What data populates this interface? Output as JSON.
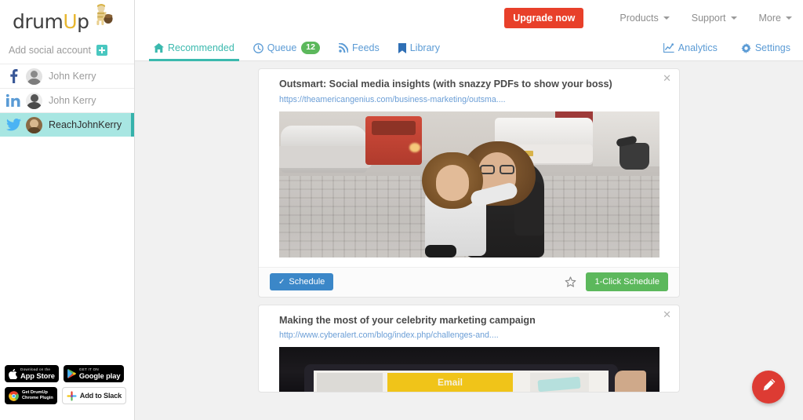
{
  "brand": {
    "name_part1": "drum",
    "name_part2": "U",
    "name_part3": "p",
    "accent_teal": "#3bb9ae",
    "accent_red": "#e8402a",
    "accent_green": "#5cb85c",
    "accent_blue": "#3b87c8"
  },
  "topbar": {
    "upgrade_label": "Upgrade now",
    "menu": [
      {
        "label": "Products",
        "icon": "chevron-down-icon"
      },
      {
        "label": "Support",
        "icon": "chevron-down-icon"
      },
      {
        "label": "More",
        "icon": "chevron-down-icon"
      }
    ]
  },
  "tabs": {
    "items": [
      {
        "label": "Recommended",
        "icon": "home-icon",
        "active": true,
        "badge": ""
      },
      {
        "label": "Queue",
        "icon": "clock-icon",
        "active": false,
        "badge": "12"
      },
      {
        "label": "Feeds",
        "icon": "rss-icon",
        "active": false,
        "badge": ""
      },
      {
        "label": "Library",
        "icon": "bookmark-icon",
        "active": false,
        "badge": ""
      }
    ],
    "right": [
      {
        "label": "Analytics",
        "icon": "chart-line-icon"
      },
      {
        "label": "Settings",
        "icon": "gear-icon"
      }
    ]
  },
  "sidebar": {
    "add_account_label": "Add social account",
    "add_account_icon": "plus-square-icon",
    "accounts": [
      {
        "name": "John Kerry",
        "network": "facebook",
        "icon": "facebook-icon",
        "active": false
      },
      {
        "name": "John Kerry",
        "network": "linkedin",
        "icon": "linkedin-icon",
        "active": false
      },
      {
        "name": "ReachJohnKerry",
        "network": "twitter",
        "icon": "twitter-icon",
        "active": true
      }
    ],
    "badges": [
      {
        "id": "app-store",
        "small": "Download on the",
        "large": "App Store",
        "icon": "apple-icon",
        "style": "dark"
      },
      {
        "id": "google-play",
        "small": "GET IT ON",
        "large": "Google play",
        "icon": "google-play-icon",
        "style": "dark"
      },
      {
        "id": "chrome-plugin",
        "line1": "Get DrumUp",
        "line2": "Chrome Plugin",
        "icon": "chrome-icon",
        "style": "dark"
      },
      {
        "id": "add-to-slack",
        "label": "Add to Slack",
        "icon": "slack-icon",
        "style": "light"
      }
    ]
  },
  "feed": {
    "cards": [
      {
        "title": "Outsmart: Social media insights (with snazzy PDFs to show your boss)",
        "url": "https://theamericangenius.com/business-marketing/outsma....",
        "close_icon": "close-icon",
        "image_alt": "woman holding a child on a cobblestone street",
        "schedule_label": "Schedule",
        "schedule_icon": "check-icon",
        "star_icon": "star-icon",
        "oneclick_label": "1-Click Schedule"
      },
      {
        "title": "Making the most of your celebrity marketing campaign",
        "url": "http://www.cyberalert.com/blog/index.php/challenges-and....",
        "close_icon": "close-icon",
        "image_alt": "tablet screen showing a yellow Email button",
        "image_text": "Email"
      }
    ]
  },
  "fab": {
    "icon": "pencil-icon",
    "color": "#dd3b33"
  }
}
